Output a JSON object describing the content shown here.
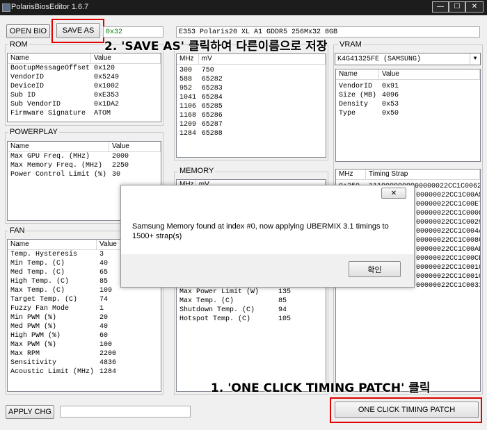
{
  "window": {
    "title": "PolarisBiosEditor 1.6.7",
    "min": "—",
    "max": "☐",
    "close": "✕"
  },
  "toolbar": {
    "open_bios": "OPEN BIO",
    "save_as": "SAVE AS",
    "checksum": "0x32",
    "bios_name": "E353 Polaris20 XL A1 GDDR5 256Mx32 8GB"
  },
  "annotations": {
    "step2": "2. 'SAVE AS' 클릭하여 다른이름으로 저장",
    "step1": "1. 'ONE CLICK TIMING PATCH' 클릭"
  },
  "rom": {
    "label": "ROM",
    "headers": [
      "Name",
      "Value"
    ],
    "rows": [
      [
        "BootupMessageOffset",
        "0x120"
      ],
      [
        "VendorID",
        "0x5249"
      ],
      [
        "DeviceID",
        "0x1002"
      ],
      [
        "Sub ID",
        "0xE353"
      ],
      [
        "Sub VendorID",
        "0x1DA2"
      ],
      [
        "Firmware Signature",
        "ATOM"
      ]
    ]
  },
  "powerplay": {
    "label": "POWERPLAY",
    "headers": [
      "Name",
      "Value"
    ],
    "rows": [
      [
        "Max GPU Freq. (MHz)",
        "2000"
      ],
      [
        "Max Memory Freq. (MHz)",
        "2250"
      ],
      [
        "Power Control Limit (%)",
        "30"
      ]
    ]
  },
  "fan": {
    "label": "FAN",
    "headers": [
      "Name",
      "Value"
    ],
    "rows": [
      [
        "Temp. Hysteresis",
        "3"
      ],
      [
        "Min Temp. (C)",
        "40"
      ],
      [
        "Med Temp. (C)",
        "65"
      ],
      [
        "High Temp. (C)",
        "85"
      ],
      [
        "Max Temp. (C)",
        "109"
      ],
      [
        "Target Temp. (C)",
        "74"
      ],
      [
        "Fuzzy Fan Mode",
        "1"
      ],
      [
        "Min PWM (%)",
        "20"
      ],
      [
        "Med PWM (%)",
        "40"
      ],
      [
        "High PWM (%)",
        "60"
      ],
      [
        "Max PWM (%)",
        "100"
      ],
      [
        "Max RPM",
        "2200"
      ],
      [
        "Sensitivity",
        "4836"
      ],
      [
        "Acoustic Limit (MHz)",
        "1284"
      ]
    ]
  },
  "gpu": {
    "headers": [
      "MHz",
      "mV"
    ],
    "rows": [
      [
        "300",
        "750"
      ],
      [
        "588",
        "65282"
      ],
      [
        "952",
        "65283"
      ],
      [
        "1041",
        "65284"
      ],
      [
        "1106",
        "65285"
      ],
      [
        "1168",
        "65286"
      ],
      [
        "1209",
        "65287"
      ],
      [
        "1284",
        "65288"
      ]
    ]
  },
  "memory": {
    "label": "MEMORY",
    "headers": [
      "MHz",
      "mV"
    ]
  },
  "vrm": {
    "rows": [
      [
        "Max Power Limit (W)",
        "135"
      ],
      [
        "Max Temp. (C)",
        "85"
      ],
      [
        "Shutdown Temp. (C)",
        "94"
      ],
      [
        "Hotspot Temp. (C)",
        "105"
      ]
    ]
  },
  "vram": {
    "label": "VRAM",
    "selected": "K4G41325FE (SAMSUNG)",
    "headers": [
      "Name",
      "Value"
    ],
    "rows": [
      [
        "VendorID",
        "0x91"
      ],
      [
        "Size (MB)",
        "4096"
      ],
      [
        "Density",
        "0x53"
      ],
      [
        "Type",
        "0x50"
      ]
    ]
  },
  "timing": {
    "headers": [
      "MHz",
      "Timing Strap"
    ],
    "first_row": [
      "0:250",
      "1110000000000000022CC1C0062"
    ],
    "straps": [
      "00000022CC1C00A5",
      "00000022CC1C00E7",
      "00000022CC1C0008",
      "00000022CC1C0029",
      "00000022CC1C004A",
      "00000022CC1C008C",
      "00000022CC1C00AD",
      "00000022CC1C00CE",
      "00000022CC1C0010",
      "00000022CC1C0010",
      "00000022CC1C0031"
    ]
  },
  "dialog": {
    "close": "✕",
    "message": "Samsung Memory found at index #0, now applying UBERMIX 3.1 timings to 1500+ strap(s)",
    "ok": "확인"
  },
  "bottom": {
    "apply": "APPLY CHG",
    "apply_field": "",
    "patch": "ONE CLICK TIMING PATCH"
  },
  "colors": {
    "annotation_red": "#e00000",
    "checksum_green": "#008000"
  }
}
